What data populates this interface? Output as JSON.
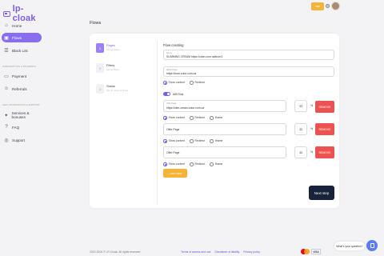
{
  "brand": {
    "name": "lp-cloak",
    "accent": "#7c5ce8"
  },
  "topbar": {
    "promo_label": "TRY",
    "lang_icon": "globe-icon"
  },
  "sidebar": {
    "items": [
      {
        "label": "Home",
        "icon": "home-icon",
        "active": false
      },
      {
        "label": "Flows",
        "icon": "flows-icon",
        "active": true
      },
      {
        "label": "Black List",
        "icon": "list-icon",
        "active": false
      }
    ],
    "section_billing": "SUBSCRIPTION & PAYMENTS",
    "billing_items": [
      {
        "label": "Payment",
        "icon": "card-icon"
      },
      {
        "label": "Referrals",
        "icon": "users-icon"
      }
    ],
    "section_support": "SELF INFORMATION & SUPPORT",
    "support_items": [
      {
        "label": "Services & bonuses",
        "icon": "gift-icon"
      },
      {
        "label": "FAQ",
        "icon": "question-icon"
      },
      {
        "label": "Support",
        "icon": "support-icon"
      }
    ]
  },
  "page": {
    "title": "Flows"
  },
  "steps": [
    {
      "num": "1",
      "title": "Pages",
      "sub": "Set up Pages",
      "active": true
    },
    {
      "num": "2",
      "title": "Filters",
      "sub": "Set up Filters",
      "active": false
    },
    {
      "num": "3",
      "title": "Status",
      "sub": "Set up name of Flows",
      "active": false
    }
  ],
  "form": {
    "title": "Flow creating",
    "name_label": "Name",
    "name_value": "SLIMMING CREAM https://cdon.com.ua/burn3",
    "white_label": "White Page",
    "white_value": "https://burn.cdon.com.ua",
    "show_content": "Show content",
    "redirect": "Redirect",
    "iframe": "Iframe",
    "ab_label": "A/B Test",
    "offer1_label": "Offer Page",
    "offer1_value": "https://slim-cream-cdon.com.ua",
    "offer1_pct": "33",
    "offer2_value": "Offer Page",
    "offer2_pct": "33",
    "offer3_value": "Offer Page",
    "offer3_pct": "33",
    "pct_sign": "%",
    "remove_label": "REMOVE",
    "add_label": "+ ADD NEW",
    "next_label": "Next step"
  },
  "footer": {
    "copyright": "2022-2024 © LP-Cloak. All rights reserved",
    "links": [
      "Terms of access and use",
      "Disclaimer of liability",
      "Privacy policy"
    ],
    "visa": "VISA",
    "chat_label": "What's your question?"
  },
  "colors": {
    "remove": "#ec5250",
    "add": "#f5b338",
    "next": "#16233a",
    "chat": "#5b7cf5"
  }
}
